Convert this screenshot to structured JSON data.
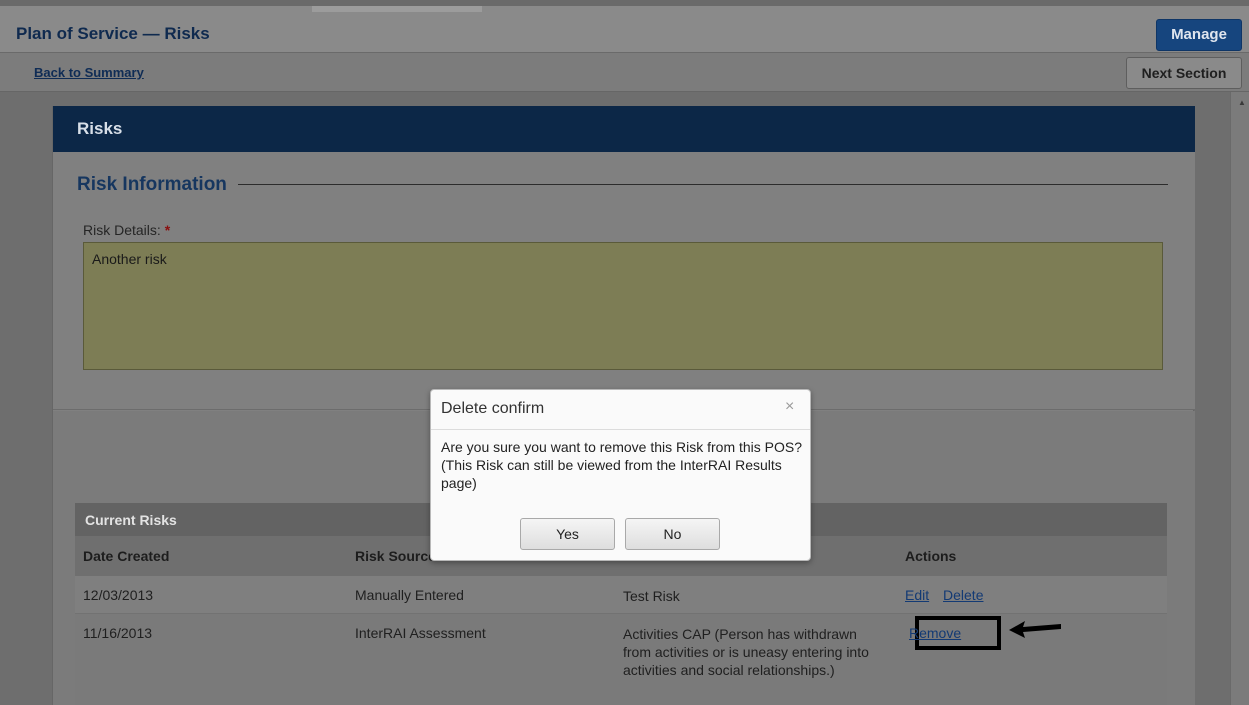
{
  "header": {
    "title": "Plan of Service — Risks",
    "manage_label": "Manage",
    "back_link": "Back to Summary",
    "next_label": "Next Section"
  },
  "panel": {
    "title": "Risks",
    "section_title": "Risk Information",
    "risk_details_label": "Risk Details:",
    "required_mark": "*",
    "risk_details_value": "Another risk"
  },
  "risks_table": {
    "title": "Current Risks",
    "columns": [
      "Date Created",
      "Risk Source",
      "",
      "Actions"
    ],
    "rows": [
      {
        "date": "12/03/2013",
        "source": "Manually Entered",
        "risk": "Test Risk",
        "actions": [
          "Edit",
          "Delete"
        ]
      },
      {
        "date": "11/16/2013",
        "source": "InterRAI Assessment",
        "risk": "Activities CAP (Person has withdrawn from activities or is uneasy entering into activities and social relationships.)",
        "actions": [
          "Remove"
        ]
      }
    ]
  },
  "dialog": {
    "title": "Delete confirm",
    "close_glyph": "×",
    "message": "Are you sure you want to remove this Risk from this POS? (This Risk can still be viewed from the InterRAI Results page)",
    "yes_label": "Yes",
    "no_label": "No"
  },
  "colors": {
    "header_navy": "#0c2747",
    "manage_blue": "#16457e",
    "textarea_fill": "#7d7d55",
    "link": "#133a74"
  },
  "icons": [
    "close-icon",
    "arrow-left-icon",
    "scroll-up-icon"
  ]
}
